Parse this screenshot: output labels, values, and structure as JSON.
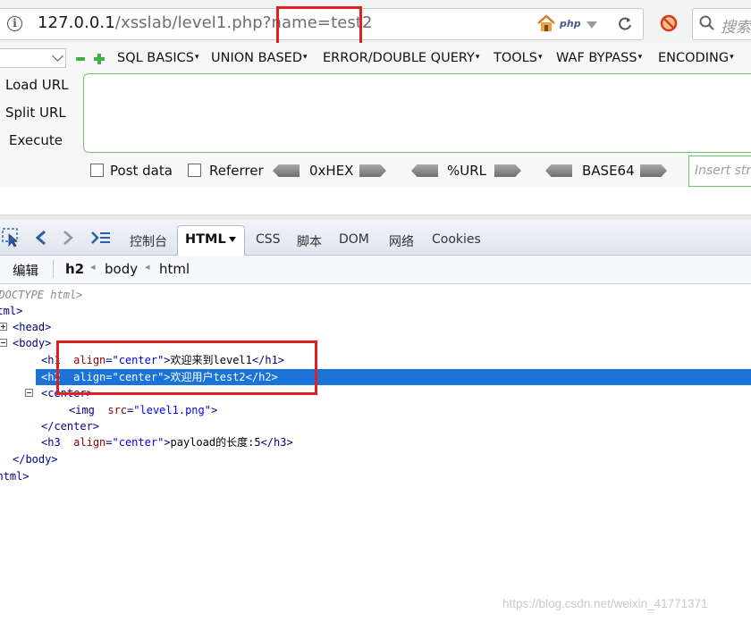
{
  "address_bar": {
    "url_host": "127.0.0.1",
    "url_path": "/xsslab/level1.php?name=test2",
    "php_badge": "php",
    "search_placeholder": "搜索"
  },
  "hackbar": {
    "menu": [
      "SQL BASICS",
      "UNION BASED",
      "ERROR/DOUBLE QUERY",
      "TOOLS",
      "WAF BYPASS",
      "ENCODING"
    ],
    "load_url": "Load URL",
    "split_url": "Split URL",
    "execute": "Execute",
    "post_data_label": "Post data",
    "referrer_label": "Referrer",
    "hex_label": "0xHEX",
    "urlenc_label": "%URL",
    "base64_label": "BASE64",
    "insert_placeholder": "Insert str"
  },
  "firebug": {
    "tabs": {
      "console": "控制台",
      "html": "HTML",
      "css": "CSS",
      "script": "脚本",
      "dom": "DOM",
      "net": "网络",
      "cookies": "Cookies"
    },
    "breadcrumb": {
      "edit": "编辑",
      "items": [
        "h2",
        "body",
        "html"
      ]
    },
    "tree": {
      "doctype": "<!DOCTYPE html>",
      "html_open": "<html>",
      "head": "<head>",
      "body_open": "<body>",
      "h1_text": "欢迎来到level1",
      "h2_text": "欢迎用户test2",
      "center_open": "<center>",
      "img_src": "\"level1.png\"",
      "center_close": "</center>",
      "h3_text": "payload的长度:5",
      "body_close": "</body>",
      "html_close": "</html>",
      "align_attr": "align",
      "align_value": "\"center\"",
      "src_attr": "src"
    }
  },
  "watermark": "https://blog.csdn.net/weixin_41771371",
  "colors": {
    "highlight_box": "#e02020",
    "selected_row": "#1a73d9",
    "tag": "#000088",
    "attr": "#880000",
    "value": "#0000ff"
  },
  "icons": [
    "info-icon",
    "home-icon",
    "dropdown-arrow-icon",
    "reload-icon",
    "noscript-icon",
    "search-icon",
    "minus-icon",
    "plus-icon",
    "inspect-icon",
    "back-icon",
    "forward-icon",
    "command-line-icon"
  ]
}
